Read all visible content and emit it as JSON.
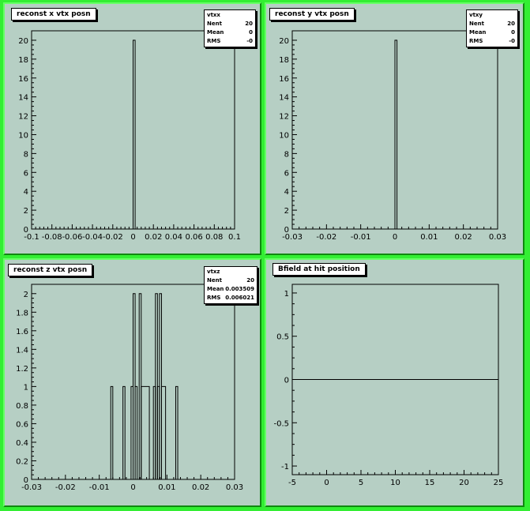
{
  "chart_data": [
    {
      "type": "histogram",
      "title": "reconst x vtx posn",
      "stats": {
        "name": "vtxx",
        "entries_label": "Nent",
        "entries": "20",
        "mean_label": "Mean",
        "mean": "0",
        "rms_label": "RMS",
        "rms": "-0"
      },
      "xlim": [
        -0.1,
        0.1
      ],
      "ylim": [
        0,
        21
      ],
      "xticks": [
        -0.1,
        -0.08,
        -0.06,
        -0.04,
        -0.02,
        0,
        0.02,
        0.04,
        0.06,
        0.08,
        0.1
      ],
      "xtick_labels": [
        "-0.1",
        "-0.08",
        "-0.06",
        "-0.04",
        "-0.02",
        "0",
        "0.02",
        "0.04",
        "0.06",
        "0.08",
        "0.1"
      ],
      "yticks": [
        0,
        2,
        4,
        6,
        8,
        10,
        12,
        14,
        16,
        18,
        20
      ],
      "bins": [
        {
          "x0": 0,
          "x1": 0.002,
          "y": 20
        }
      ]
    },
    {
      "type": "histogram",
      "title": "reconst y vtx posn",
      "stats": {
        "name": "vtxy",
        "entries_label": "Nent",
        "entries": "20",
        "mean_label": "Mean",
        "mean": "0",
        "rms_label": "RMS",
        "rms": "-0"
      },
      "xlim": [
        -0.03,
        0.03
      ],
      "ylim": [
        0,
        21
      ],
      "xticks": [
        -0.03,
        -0.02,
        -0.01,
        0,
        0.01,
        0.02,
        0.03
      ],
      "xtick_labels": [
        "-0.03",
        "-0.02",
        "-0.01",
        "0",
        "0.01",
        "0.02",
        "0.03"
      ],
      "yticks": [
        0,
        2,
        4,
        6,
        8,
        10,
        12,
        14,
        16,
        18,
        20
      ],
      "bins": [
        {
          "x0": 0,
          "x1": 0.0006,
          "y": 20
        }
      ]
    },
    {
      "type": "histogram",
      "title": "reconst z vtx posn",
      "stats": {
        "name": "vtxz",
        "entries_label": "Nent",
        "entries": "20",
        "mean_label": "Mean",
        "mean": "0.003509",
        "rms_label": "RMS",
        "rms": "0.006021"
      },
      "xlim": [
        -0.03,
        0.03
      ],
      "ylim": [
        0,
        2.1
      ],
      "xticks": [
        -0.03,
        -0.02,
        -0.01,
        0,
        0.01,
        0.02,
        0.03
      ],
      "xtick_labels": [
        "-0.03",
        "-0.02",
        "-0.01",
        "0",
        "0.01",
        "0.02",
        "0.03"
      ],
      "yticks": [
        0,
        0.2,
        0.4,
        0.6,
        0.8,
        1,
        1.2,
        1.4,
        1.6,
        1.8,
        2
      ],
      "bins": [
        {
          "x0": -0.0066,
          "x1": -0.006,
          "y": 1
        },
        {
          "x0": -0.003,
          "x1": -0.0024,
          "y": 1
        },
        {
          "x0": -0.0006,
          "x1": 0.0,
          "y": 1
        },
        {
          "x0": 0.0,
          "x1": 0.0006,
          "y": 2
        },
        {
          "x0": 0.0006,
          "x1": 0.0012,
          "y": 1
        },
        {
          "x0": 0.0018,
          "x1": 0.0024,
          "y": 2
        },
        {
          "x0": 0.0024,
          "x1": 0.0048,
          "y": 1
        },
        {
          "x0": 0.006,
          "x1": 0.0066,
          "y": 1
        },
        {
          "x0": 0.0066,
          "x1": 0.0072,
          "y": 2
        },
        {
          "x0": 0.0072,
          "x1": 0.0078,
          "y": 1
        },
        {
          "x0": 0.0078,
          "x1": 0.0084,
          "y": 2
        },
        {
          "x0": 0.0084,
          "x1": 0.0096,
          "y": 1
        },
        {
          "x0": 0.0126,
          "x1": 0.0132,
          "y": 1
        }
      ]
    },
    {
      "type": "line",
      "title": "Bfield at hit position",
      "xlim": [
        -5,
        25
      ],
      "ylim": [
        -1.1,
        1.1
      ],
      "xticks": [
        -5,
        0,
        5,
        10,
        15,
        20,
        25
      ],
      "xtick_labels": [
        "-5",
        "0",
        "5",
        "10",
        "15",
        "20",
        "25"
      ],
      "yticks": [
        -1,
        -0.5,
        0,
        0.5,
        1
      ],
      "ytick_labels": [
        "-1",
        "-0.5",
        "0",
        "0.5",
        "1"
      ],
      "series": [
        {
          "x": [
            -5,
            25
          ],
          "y": [
            0,
            0
          ]
        }
      ]
    }
  ]
}
